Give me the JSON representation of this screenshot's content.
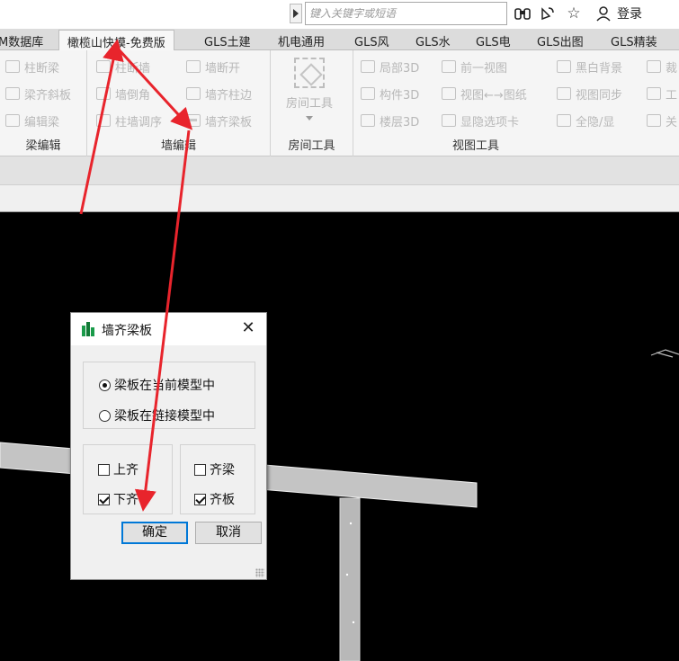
{
  "search": {
    "placeholder": "键入关键字或短语"
  },
  "top_icons": [
    "binoculars-icon",
    "satellite-icon",
    "star-icon",
    "user-icon"
  ],
  "login_label": "登录",
  "tabs": [
    {
      "label": "M数据库"
    },
    {
      "label": "橄榄山快模-免费版",
      "active": true
    },
    {
      "label": "GLS土建"
    },
    {
      "label": "机电通用"
    },
    {
      "label": "GLS风"
    },
    {
      "label": "GLS水"
    },
    {
      "label": "GLS电"
    },
    {
      "label": "GLS出图"
    },
    {
      "label": "GLS精装"
    }
  ],
  "groups": {
    "beam_edit": {
      "label": "梁编辑",
      "buttons": [
        "柱断梁",
        "梁齐斜板",
        "编辑梁"
      ]
    },
    "wall_edit": {
      "label": "墙编辑",
      "buttons": [
        "柱断墙",
        "墙倒角",
        "柱墙调序",
        "墙断开",
        "墙齐柱边",
        "墙齐梁板"
      ]
    },
    "room_tools": {
      "label": "房间工具",
      "button": "房间工具"
    },
    "view_tools": {
      "label": "视图工具",
      "buttons": [
        "局部3D",
        "构件3D",
        "楼层3D",
        "前一视图",
        "视图←→图纸",
        "显隐选项卡",
        "黑白背景",
        "视图同步",
        "全隐/显",
        "裁",
        "工",
        "关"
      ]
    }
  },
  "dialog": {
    "title": "墙齐梁板",
    "radio_options": [
      {
        "label": "梁板在当前模型中",
        "selected": true
      },
      {
        "label": "梁板在链接模型中",
        "selected": false
      }
    ],
    "align_options": [
      {
        "label": "上齐",
        "checked": false
      },
      {
        "label": "下齐",
        "checked": true
      }
    ],
    "target_options": [
      {
        "label": "齐梁",
        "checked": false
      },
      {
        "label": "齐板",
        "checked": true
      }
    ],
    "ok_label": "确定",
    "cancel_label": "取消"
  },
  "colors": {
    "annotation_arrow": "#e8242c",
    "dialog_focus": "#0078d7",
    "viewport_bg": "#000000"
  }
}
